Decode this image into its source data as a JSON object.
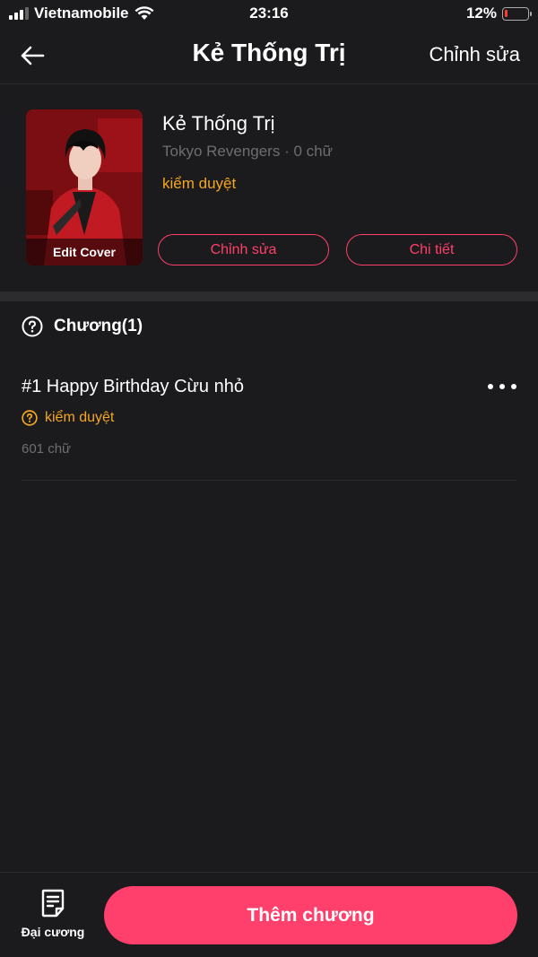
{
  "status_bar": {
    "carrier": "Vietnamobile",
    "time": "23:16",
    "battery": "12%",
    "battery_level": 0.12,
    "battery_color": "#ff3b30"
  },
  "header": {
    "title": "Kẻ Thống Trị",
    "edit_label": "Chỉnh sửa",
    "back_icon": "arrow-left-icon"
  },
  "book": {
    "title": "Kẻ Thống Trị",
    "meta": "Tokyo Revengers · 0 chữ",
    "status": "kiểm duyệt",
    "cover_label": "Edit Cover",
    "edit_button": "Chỉnh sửa",
    "detail_button": "Chi tiết"
  },
  "chapters": {
    "header": "Chương(1)",
    "items": [
      {
        "title": "#1 Happy Birthday Cừu nhỏ",
        "status": "kiểm duyệt",
        "words": "601 chữ"
      }
    ]
  },
  "bottom": {
    "outline_label": "Đại cương",
    "add_button": "Thêm chương"
  },
  "colors": {
    "accent": "#ff3f6c",
    "pending": "#f5a623",
    "background": "#1b1b1d"
  }
}
